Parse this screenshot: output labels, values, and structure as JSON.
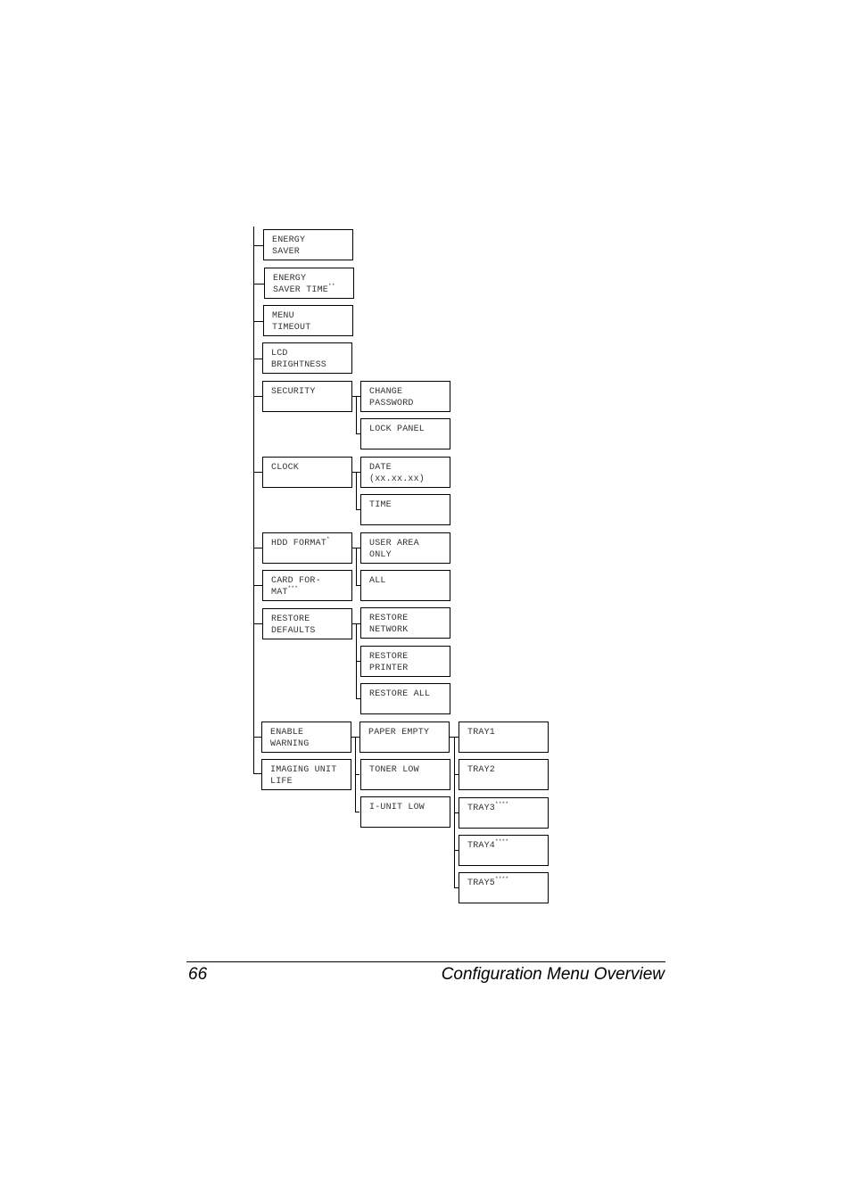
{
  "diagram": {
    "level1": [
      {
        "label_line1": "ENERGY",
        "label_line2": "SAVER",
        "sup": ""
      },
      {
        "label_line1": "ENERGY",
        "label_line2": "SAVER TIME",
        "sup": "**"
      },
      {
        "label_line1": "MENU",
        "label_line2": "TIMEOUT",
        "sup": ""
      },
      {
        "label_line1": "LCD",
        "label_line2": "BRIGHTNESS",
        "sup": ""
      },
      {
        "label_line1": "SECURITY",
        "label_line2": "",
        "sup": ""
      },
      {
        "label_line1": "CLOCK",
        "label_line2": "",
        "sup": ""
      },
      {
        "label_line1": "HDD FORMAT",
        "label_line2": "",
        "sup": "*"
      },
      {
        "label_line1": "CARD FOR-",
        "label_line2": "MAT",
        "sup": "***"
      },
      {
        "label_line1": "RESTORE",
        "label_line2": "DEFAULTS",
        "sup": ""
      },
      {
        "label_line1": "ENABLE",
        "label_line2": "WARNING",
        "sup": ""
      },
      {
        "label_line1": "IMAGING UNIT",
        "label_line2": "LIFE",
        "sup": ""
      }
    ],
    "security_children": [
      {
        "label_line1": "CHANGE",
        "label_line2": "PASSWORD"
      },
      {
        "label_line1": "LOCK PANEL",
        "label_line2": ""
      }
    ],
    "clock_children": [
      {
        "label_line1": "DATE",
        "label_line2": "(xx.xx.xx)"
      },
      {
        "label_line1": "TIME",
        "label_line2": ""
      }
    ],
    "format_children": [
      {
        "label_line1": "USER AREA",
        "label_line2": "ONLY"
      },
      {
        "label_line1": "ALL",
        "label_line2": ""
      }
    ],
    "restore_children": [
      {
        "label_line1": "RESTORE",
        "label_line2": "NETWORK"
      },
      {
        "label_line1": "RESTORE",
        "label_line2": "PRINTER"
      },
      {
        "label_line1": "RESTORE ALL",
        "label_line2": ""
      }
    ],
    "warning_children": [
      {
        "label_line1": "PAPER EMPTY",
        "label_line2": ""
      },
      {
        "label_line1": "TONER LOW",
        "label_line2": ""
      },
      {
        "label_line1": "I-UNIT LOW",
        "label_line2": ""
      }
    ],
    "paper_empty_children": [
      {
        "label": "TRAY1",
        "sup": ""
      },
      {
        "label": "TRAY2",
        "sup": ""
      },
      {
        "label": "TRAY3",
        "sup": "****"
      },
      {
        "label": "TRAY4",
        "sup": "****"
      },
      {
        "label": "TRAY5",
        "sup": "****"
      }
    ]
  },
  "footer": {
    "page_number": "66",
    "section_title": "Configuration Menu Overview"
  }
}
